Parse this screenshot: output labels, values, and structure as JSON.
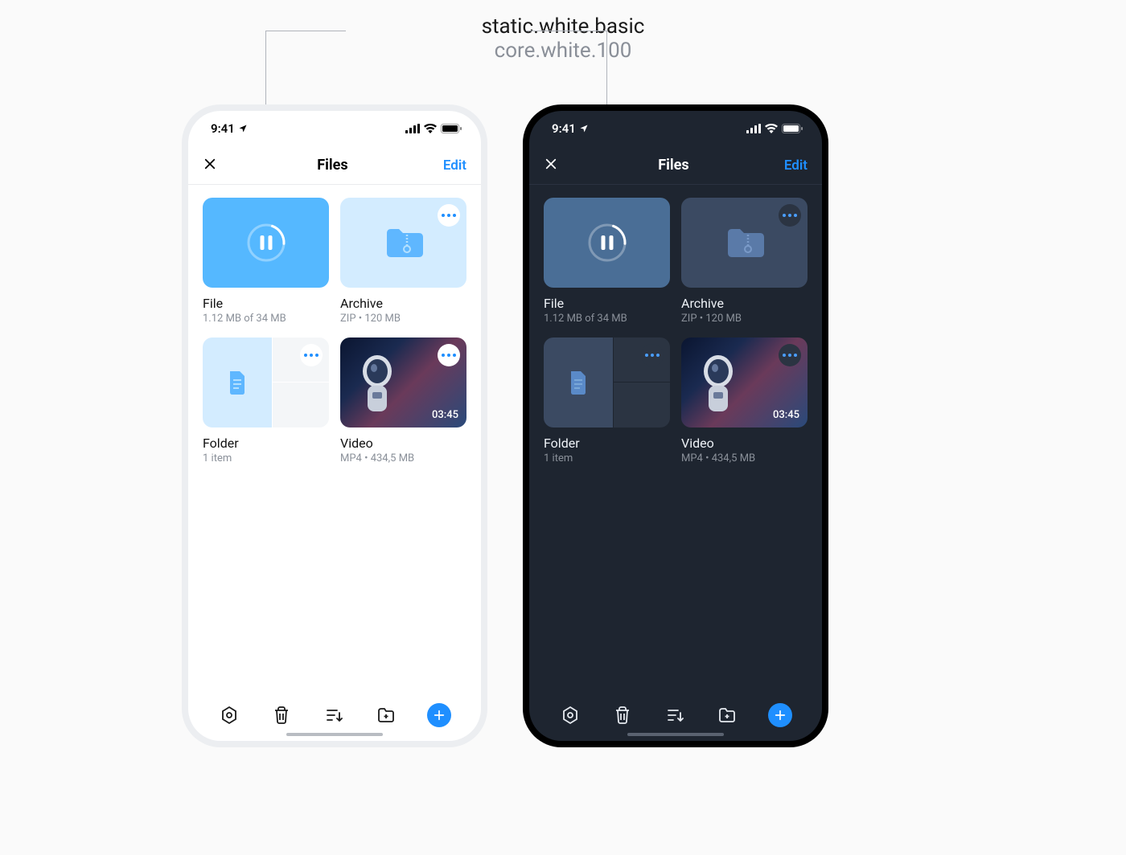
{
  "annotation": {
    "token_name": "static.white.basic",
    "token_value": "core.white.100"
  },
  "status": {
    "time": "9:41"
  },
  "nav": {
    "title": "Files",
    "edit_label": "Edit"
  },
  "tiles": {
    "file": {
      "title": "File",
      "subtitle": "1.12 MB of 34 MB"
    },
    "archive": {
      "title": "Archive",
      "subtitle": "ZIP • 120 MB"
    },
    "folder": {
      "title": "Folder",
      "subtitle": "1 item"
    },
    "video": {
      "title": "Video",
      "subtitle": "MP4 • 434,5 MB",
      "duration": "03:45"
    }
  }
}
